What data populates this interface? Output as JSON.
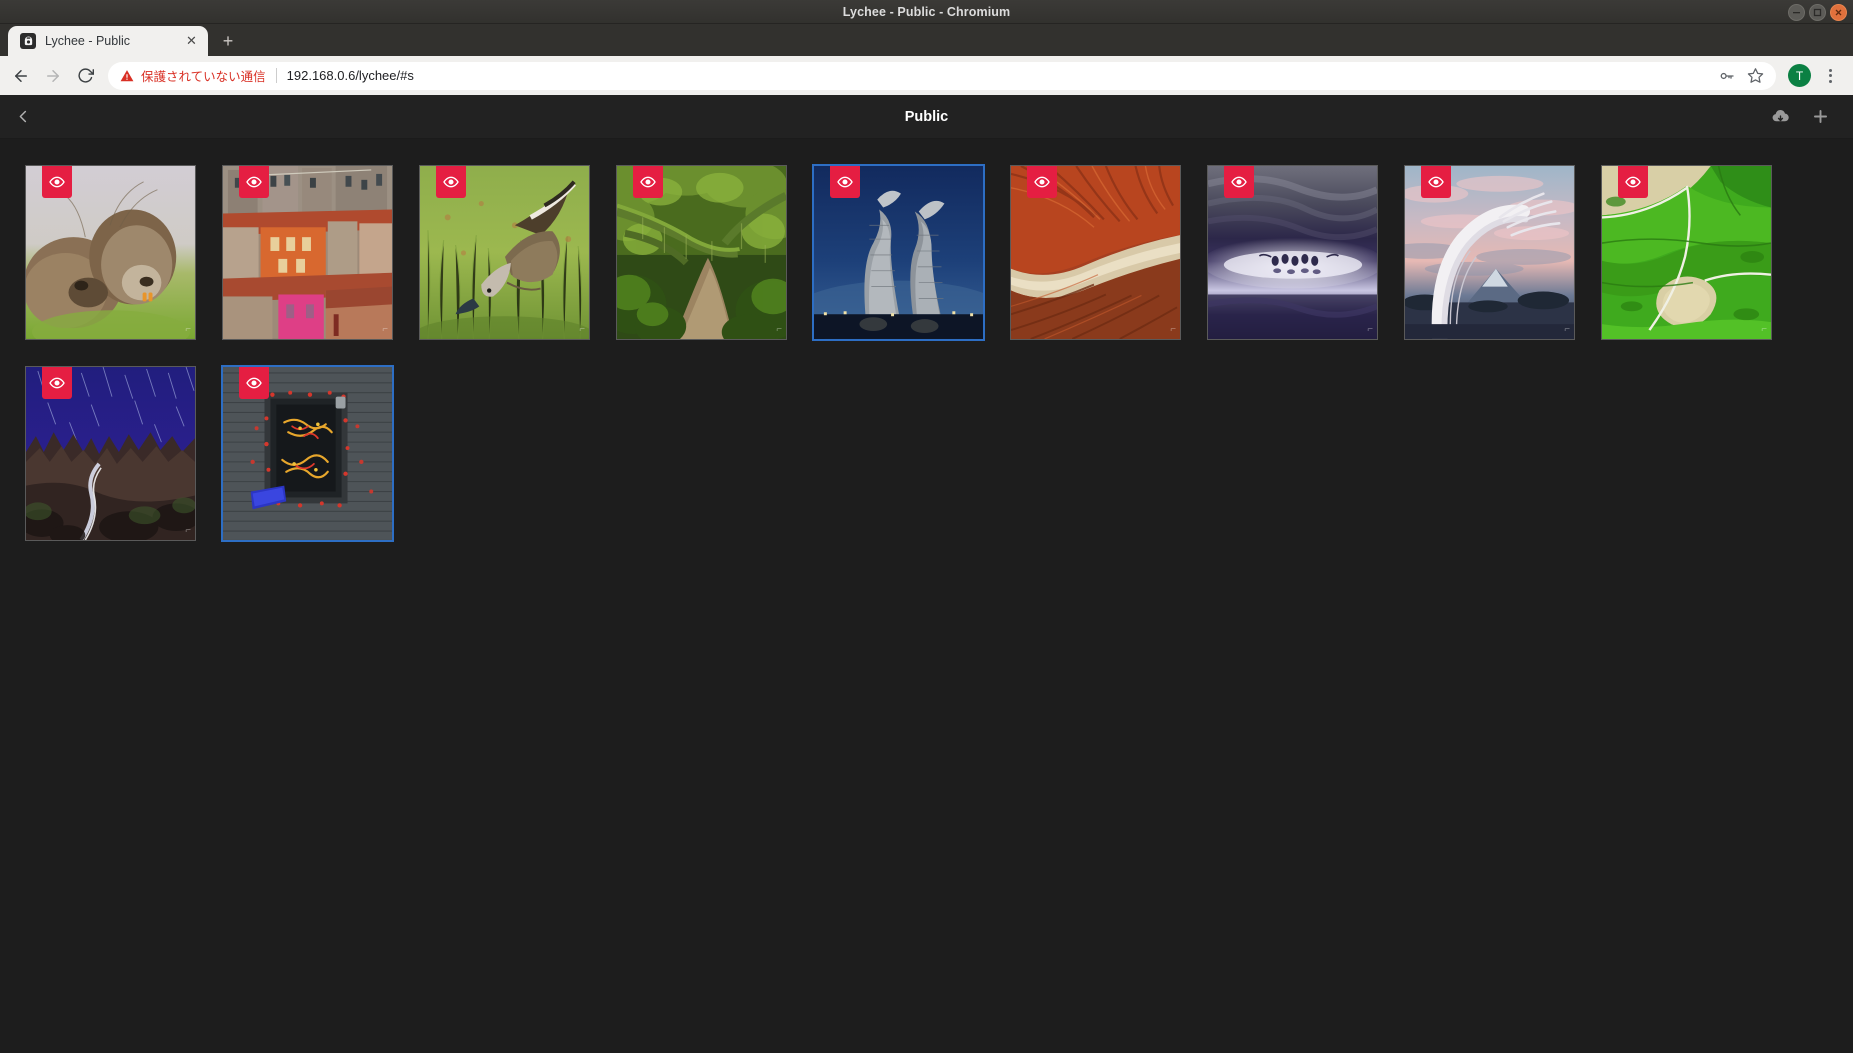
{
  "window": {
    "title": "Lychee - Public - Chromium",
    "controls": [
      {
        "name": "minimize",
        "glyph": "–"
      },
      {
        "name": "maximize",
        "glyph": "□"
      },
      {
        "name": "close",
        "glyph": "✕"
      }
    ]
  },
  "browser": {
    "tab": {
      "title": "Lychee - Public",
      "favicon": "lychee-logo-icon",
      "close_label": "✕"
    },
    "new_tab_label": "+",
    "nav": {
      "back_icon": "arrow-left-icon",
      "forward_icon": "arrow-right-icon",
      "reload_icon": "reload-icon"
    },
    "omnibox": {
      "security_warning": "保護されていない通信",
      "url": "192.168.0.6/lychee/#s",
      "warning_color": "#d93025",
      "key_icon": "password-key-icon",
      "star_icon": "bookmark-star-icon"
    },
    "profile": {
      "initial": "T",
      "color": "#0b8043"
    },
    "menu_icon": "kebab-menu-icon"
  },
  "app": {
    "header": {
      "back_icon": "chevron-left-icon",
      "title": "Public",
      "import_icon": "cloud-download-icon",
      "add_icon": "plus-icon"
    },
    "badge": {
      "icon": "eye-icon",
      "color": "#e51e42"
    },
    "photos": [
      {
        "name": "marmots",
        "selected": false,
        "row": 1
      },
      {
        "name": "italian-rooftops",
        "selected": false,
        "row": 1
      },
      {
        "name": "bird-in-grass",
        "selected": false,
        "row": 1
      },
      {
        "name": "mossy-forest-path",
        "selected": false,
        "row": 1
      },
      {
        "name": "kelpies-sculpture",
        "selected": true,
        "row": 1
      },
      {
        "name": "red-canyon",
        "selected": false,
        "row": 1
      },
      {
        "name": "purple-long-exposure",
        "selected": false,
        "row": 1
      },
      {
        "name": "white-pavilion-sunset",
        "selected": false,
        "row": 2
      },
      {
        "name": "green-fields-aerial",
        "selected": false,
        "row": 2
      },
      {
        "name": "night-sky-canyon",
        "selected": false,
        "row": 2
      },
      {
        "name": "rooftop-aerial-dark",
        "selected": true,
        "row": 2
      }
    ]
  }
}
